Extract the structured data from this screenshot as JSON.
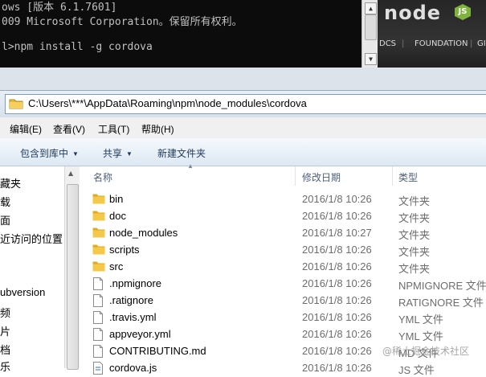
{
  "console": {
    "lines": [
      "ows [版本 6.1.7601]",
      "009 Microsoft Corporation。保留所有权利。",
      "",
      "l>npm install -g cordova"
    ]
  },
  "website": {
    "logo_text": "node",
    "logo_badge": "JS",
    "nav": [
      "DCS",
      "FOUNDATION",
      "GI"
    ]
  },
  "explorer": {
    "address": "C:\\Users\\***\\AppData\\Roaming\\npm\\node_modules\\cordova",
    "menu": [
      "编辑(E)",
      "查看(V)",
      "工具(T)",
      "帮助(H)"
    ],
    "toolbar": {
      "include_library": "包含到库中",
      "share": "共享",
      "new_folder": "新建文件夹"
    },
    "nav_items": [
      "藏夹",
      "载",
      "面",
      "近访问的位置",
      "ubversion",
      "频",
      "片",
      "档",
      "乐"
    ],
    "columns": {
      "name": "名称",
      "date": "修改日期",
      "type": "类型"
    },
    "files": [
      {
        "name": "bin",
        "date": "2016/1/8 10:26",
        "type": "文件夹",
        "icon": "folder-icon"
      },
      {
        "name": "doc",
        "date": "2016/1/8 10:26",
        "type": "文件夹",
        "icon": "folder-icon"
      },
      {
        "name": "node_modules",
        "date": "2016/1/8 10:27",
        "type": "文件夹",
        "icon": "folder-icon"
      },
      {
        "name": "scripts",
        "date": "2016/1/8 10:26",
        "type": "文件夹",
        "icon": "folder-icon"
      },
      {
        "name": "src",
        "date": "2016/1/8 10:26",
        "type": "文件夹",
        "icon": "folder-icon"
      },
      {
        "name": ".npmignore",
        "date": "2016/1/8 10:26",
        "type": "NPMIGNORE 文件",
        "icon": "file-icon"
      },
      {
        "name": ".ratignore",
        "date": "2016/1/8 10:26",
        "type": "RATIGNORE 文件",
        "icon": "file-icon"
      },
      {
        "name": ".travis.yml",
        "date": "2016/1/8 10:26",
        "type": "YML 文件",
        "icon": "file-icon"
      },
      {
        "name": "appveyor.yml",
        "date": "2016/1/8 10:26",
        "type": "YML 文件",
        "icon": "file-icon"
      },
      {
        "name": "CONTRIBUTING.md",
        "date": "2016/1/8 10:26",
        "type": "MD 文件",
        "icon": "file-icon"
      },
      {
        "name": "cordova.js",
        "date": "2016/1/8 10:26",
        "type": "JS 文件",
        "icon": "script-file-icon"
      }
    ]
  },
  "watermark": "@稀土掘金技术社区"
}
